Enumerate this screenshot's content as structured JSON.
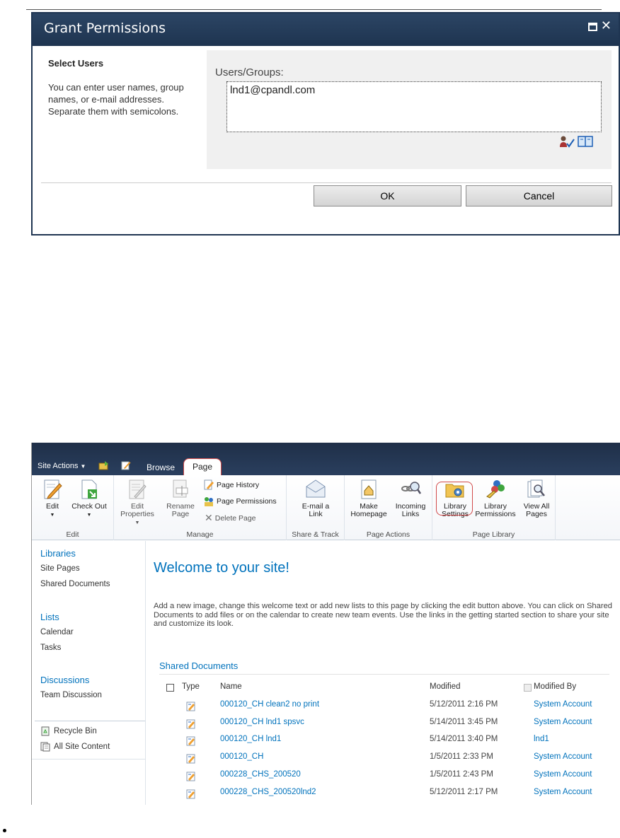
{
  "dialog": {
    "title": "Grant Permissions",
    "section_title": "Select Users",
    "help_text": "You can enter user names, group names, or e-mail addresses. Separate them with semicolons.",
    "field_label": "Users/Groups:",
    "field_value": "lnd1@cpandl.com",
    "ok_label": "OK",
    "cancel_label": "Cancel"
  },
  "sharepoint": {
    "site_actions": "Site Actions",
    "tabs": {
      "browse": "Browse",
      "page": "Page"
    },
    "ribbon": {
      "groups": {
        "edit": "Edit",
        "manage": "Manage",
        "share": "Share & Track",
        "actions": "Page Actions",
        "library": "Page Library"
      },
      "buttons": {
        "edit": "Edit",
        "check_out": "Check Out",
        "edit_properties_1": "Edit",
        "edit_properties_2": "Properties",
        "rename_1": "Rename",
        "rename_2": "Page",
        "page_history": "Page History",
        "page_permissions": "Page Permissions",
        "delete_page": "Delete Page",
        "email_1": "E-mail a",
        "email_2": "Link",
        "make_home_1": "Make",
        "make_home_2": "Homepage",
        "incoming_1": "Incoming",
        "incoming_2": "Links",
        "lib_settings_1": "Library",
        "lib_settings_2": "Settings",
        "lib_perms_1": "Library",
        "lib_perms_2": "Permissions",
        "view_all_1": "View All",
        "view_all_2": "Pages"
      }
    },
    "nav": {
      "libraries": "Libraries",
      "site_pages": "Site Pages",
      "shared_documents": "Shared Documents",
      "lists": "Lists",
      "calendar": "Calendar",
      "tasks": "Tasks",
      "discussions": "Discussions",
      "team_discussion": "Team Discussion",
      "recycle_bin": "Recycle Bin",
      "all_site_content": "All Site Content"
    },
    "main": {
      "welcome": "Welcome to your site!",
      "intro": "Add a new image, change this welcome text or add new lists to this page by clicking the edit button above. You can click on Shared Documents to add files or on the calendar to create new team events. Use the links in the getting started section to share your site and customize its look.",
      "doc_title": "Shared Documents",
      "columns": {
        "type": "Type",
        "name": "Name",
        "modified": "Modified",
        "modified_by": "Modified By"
      },
      "rows": [
        {
          "name": "000120_CH clean2 no print",
          "modified": "5/12/2011 2:16 PM",
          "by": "System Account"
        },
        {
          "name": "000120_CH lnd1 spsvc",
          "modified": "5/14/2011 3:45 PM",
          "by": "System Account"
        },
        {
          "name": "000120_CH lnd1",
          "modified": "5/14/2011 3:40 PM",
          "by": "lnd1"
        },
        {
          "name": "000120_CH",
          "modified": "1/5/2011 2:33 PM",
          "by": "System Account"
        },
        {
          "name": "000228_CHS_200520",
          "modified": "1/5/2011 2:43 PM",
          "by": "System Account"
        },
        {
          "name": "000228_CHS_200520lnd2",
          "modified": "5/12/2011 2:17 PM",
          "by": "System Account"
        }
      ]
    }
  }
}
